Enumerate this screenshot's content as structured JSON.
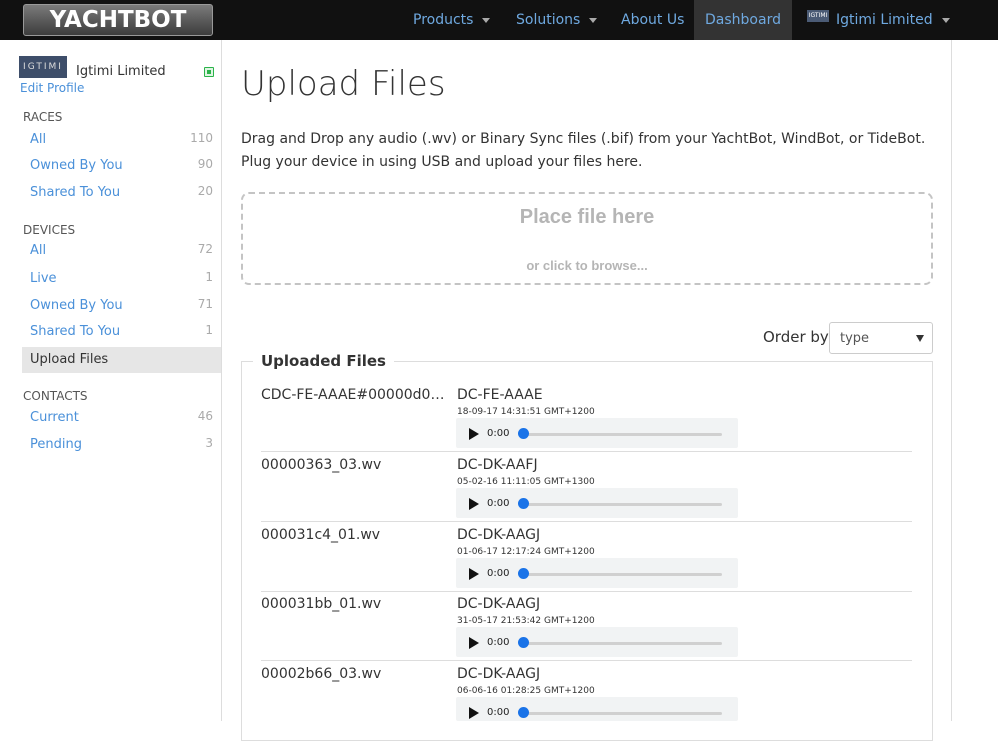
{
  "header": {
    "logo_text": "YACHTBOT",
    "nav": [
      {
        "label": "Products",
        "has_caret": true
      },
      {
        "label": "Solutions",
        "has_caret": true
      },
      {
        "label": "About Us",
        "has_caret": false
      },
      {
        "label": "Dashboard",
        "has_caret": false,
        "active": true
      },
      {
        "label": "Igtimi Limited",
        "has_caret": true,
        "logo_text": "IGTIMI"
      }
    ]
  },
  "sidebar": {
    "org_name": "Igtimi Limited",
    "avatar_text": "IGTIMI",
    "edit_profile": "Edit Profile",
    "sections": [
      {
        "title": "RACES",
        "items": [
          {
            "label": "All",
            "count": "110"
          },
          {
            "label": "Owned By You",
            "count": "90"
          },
          {
            "label": "Shared To You",
            "count": "20"
          }
        ]
      },
      {
        "title": "DEVICES",
        "items": [
          {
            "label": "All",
            "count": "72"
          },
          {
            "label": "Live",
            "count": "1"
          },
          {
            "label": "Owned By You",
            "count": "71"
          },
          {
            "label": "Shared To You",
            "count": "1"
          },
          {
            "label": "Upload Files",
            "count": "",
            "active": true
          }
        ]
      },
      {
        "title": "CONTACTS",
        "items": [
          {
            "label": "Current",
            "count": "46"
          },
          {
            "label": "Pending",
            "count": "3"
          }
        ]
      }
    ]
  },
  "main": {
    "title": "Upload Files",
    "intro_line1": "Drag and Drop any audio (.wv) or Binary Sync files (.bif) from your YachtBot, WindBot, or TideBot.",
    "intro_line2": "Plug your device in using USB and upload your files here.",
    "dropzone": {
      "title": "Place file here",
      "subtitle": "or click to browse..."
    },
    "order_by": {
      "label": "Order by",
      "selected": "type"
    },
    "uploaded_title": "Uploaded Files",
    "files": [
      {
        "name": "CDC-FE-AAAE#00000d07_...",
        "device": "DC-FE-AAAE",
        "timestamp": "18-09-17 14:31:51 GMT+1200",
        "time": "0:00"
      },
      {
        "name": "00000363_03.wv",
        "device": "DC-DK-AAFJ",
        "timestamp": "05-02-16 11:11:05 GMT+1300",
        "time": "0:00"
      },
      {
        "name": "000031c4_01.wv",
        "device": "DC-DK-AAGJ",
        "timestamp": "01-06-17 12:17:24 GMT+1200",
        "time": "0:00"
      },
      {
        "name": "000031bb_01.wv",
        "device": "DC-DK-AAGJ",
        "timestamp": "31-05-17 21:53:42 GMT+1200",
        "time": "0:00"
      },
      {
        "name": "00002b66_03.wv",
        "device": "DC-DK-AAGJ",
        "timestamp": "06-06-16 01:28:25 GMT+1200",
        "time": "0:00"
      }
    ]
  }
}
